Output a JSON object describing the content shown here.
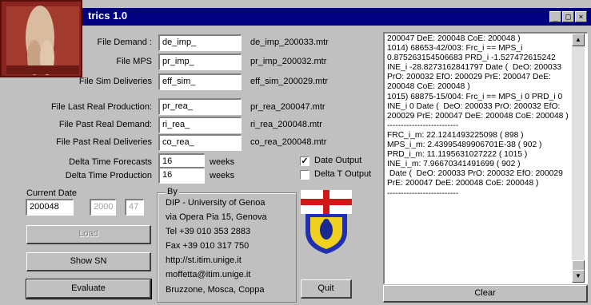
{
  "window": {
    "title": "trics 1.0",
    "minimize_glyph": "_",
    "maximize_glyph": "□",
    "close_glyph": "×"
  },
  "files": [
    {
      "label": "File Demand :",
      "value": "de_imp_",
      "output": "de_imp_200033.mtr"
    },
    {
      "label": "File MPS",
      "value": "pr_imp_",
      "output": "pr_imp_200032.mtr"
    },
    {
      "label": "File Sim Deliveries",
      "value": "eff_sim_",
      "output": "eff_sim_200029.mtr"
    },
    {
      "label": "File Last Real Production:",
      "value": "pr_rea_",
      "output": "pr_rea_200047.mtr"
    },
    {
      "label": "File Past Real Demand:",
      "value": "ri_rea_",
      "output": "ri_rea_200048.mtr"
    },
    {
      "label": "File Past Real Deliveries",
      "value": "co_rea_",
      "output": "co_rea_200048.mtr"
    }
  ],
  "delta": {
    "forecasts_label": "Delta Time Forecasts",
    "forecasts_value": "16",
    "production_label": "Delta Time  Production",
    "production_value": "16",
    "unit": "weeks"
  },
  "options": {
    "date_output_label": "Date Output",
    "date_output_checked": true,
    "delta_t_output_label": "Delta T Output",
    "delta_t_output_checked": false,
    "check_mark": "✓"
  },
  "current_date": {
    "label": "Current Date",
    "value": "200048",
    "year": "2000",
    "week": "47"
  },
  "buttons": {
    "load": "Load",
    "show_sn": "Show SN",
    "evaluate": "Evaluate",
    "quit": "Quit",
    "clear": "Clear"
  },
  "credits": {
    "group_label": "By",
    "lines": [
      "DIP - University of Genoa",
      "via Opera Pia 15, Genova",
      "Tel +39 010 353 2883",
      "Fax +39 010 317 750",
      "http://st.itim.unige.it",
      "moffetta@itim.unige.it",
      "Bruzzone, Mosca, Coppa"
    ]
  },
  "output_log": "200047 DeE: 200048 CoE: 200048 )\n1014) 68653-42/003: Frc_i == MPS_i 0.875263154506683 PRD_i -1.527472615242 INE_i -28.8273162841797 Date (  DeO: 200033 PrO: 200032 EfO: 200029 PrE: 200047 DeE: 200048 CoE: 200048 )\n1015) 68875-15/004: Frc_i == MPS_i 0 PRD_i 0 INE_i 0 Date (  DeO: 200033 PrO: 200032 EfO: 200029 PrE: 200047 DeE: 200048 CoE: 200048 )\n--------------------------\nFRC_i_m: 22.1241493225098 ( 898 )\nMPS_i_m: 2.43995489906701E-38 ( 902 )\nPRD_i_m: 11.1195631027222 ( 1015 )\nINE_i_m: 7.96670341491699 ( 902 )\n Date (  DeO: 200033 PrO: 200032 EfO: 200029 PrE: 200047 DeE: 200048 CoE: 200048 )\n--------------------------",
  "colors": {
    "titlebar": "#000080",
    "face": "#c0c0c0",
    "photo": "#8a2420"
  }
}
